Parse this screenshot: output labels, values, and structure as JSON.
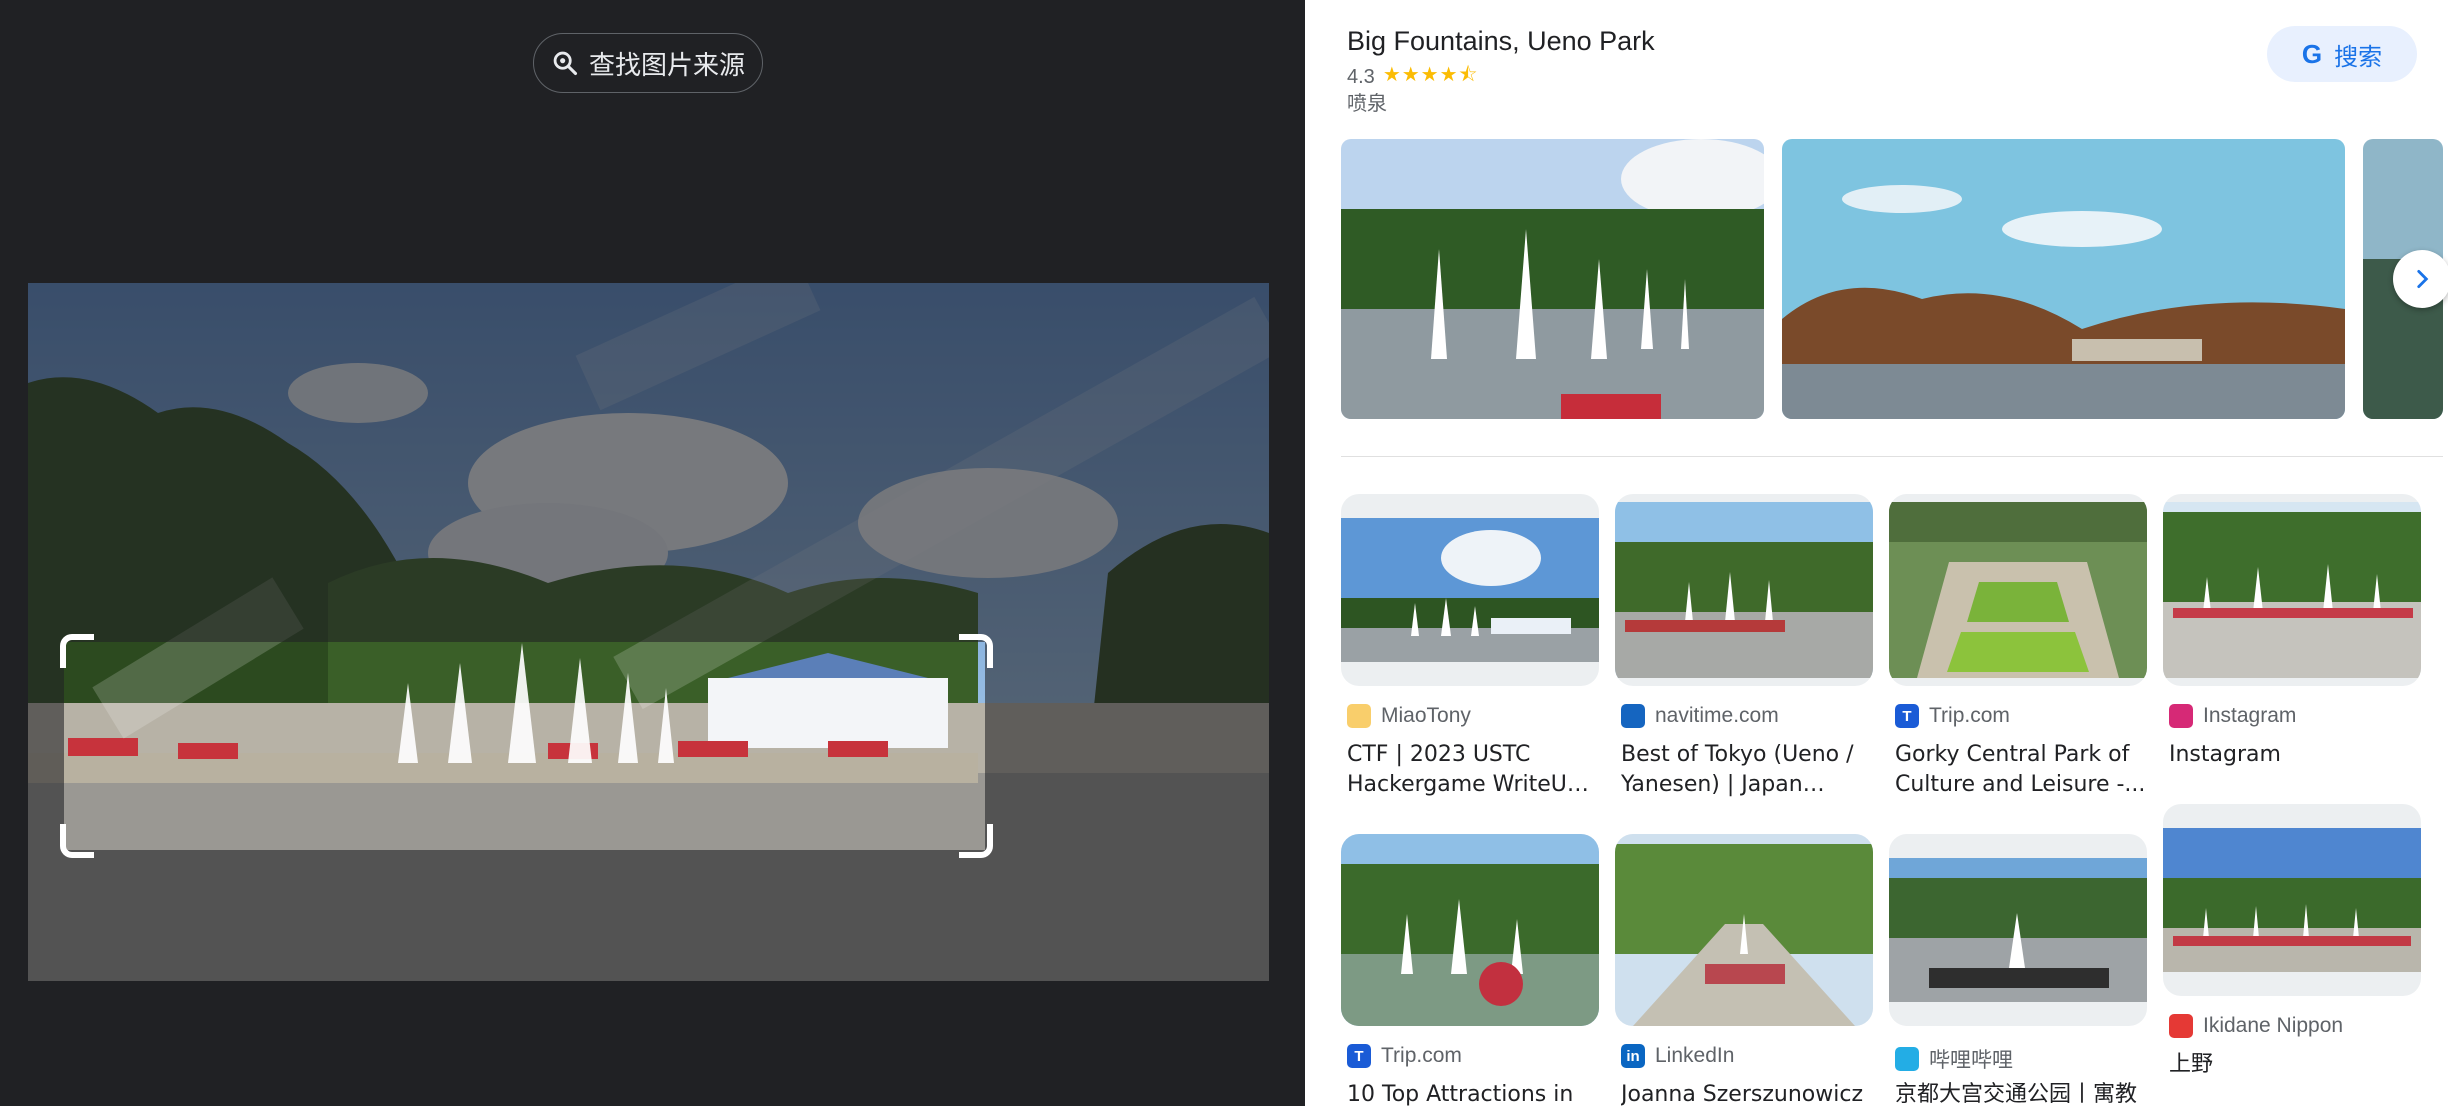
{
  "left_panel": {
    "find_source_label": "查找图片来源"
  },
  "place": {
    "title": "Big Fountains, Ueno Park",
    "rating": "4.3",
    "stars": "★★★★⯪",
    "category": "喷泉",
    "search_label": "搜索",
    "search_logo": "G"
  },
  "results": [
    {
      "source": "MiaoTony",
      "title": "CTF | 2023 USTC Hackergame WriteUp |...",
      "favicon": "notepad-icon",
      "favicon_color": "#f9ce6b"
    },
    {
      "source": "navitime.com",
      "title": "Best of Tokyo (Ueno / Yanesen) | Japan Trave...",
      "favicon": "navitime-icon",
      "favicon_color": "#1565c0"
    },
    {
      "source": "Trip.com",
      "title": "Gorky Central Park of Culture and Leisure -...",
      "favicon": "tripcom-icon",
      "favicon_text": "T",
      "favicon_color": "#1a5bd6"
    },
    {
      "source": "Instagram",
      "title": "Instagram",
      "favicon": "instagram-icon",
      "favicon_color": "#d62976"
    },
    {
      "source": "Trip.com",
      "title": "10 Top Attractions in",
      "favicon": "tripcom-icon",
      "favicon_text": "T",
      "favicon_color": "#1a5bd6"
    },
    {
      "source": "LinkedIn",
      "title": "Joanna Szerszunowicz",
      "favicon": "linkedin-icon",
      "favicon_text": "in",
      "favicon_color": "#0a66c2"
    },
    {
      "source": "哔哩哔哩",
      "title": "京都大宫交通公园丨寓教",
      "favicon": "bilibili-icon",
      "favicon_color": "#23ade5"
    },
    {
      "source": "Ikidane Nippon",
      "title": "上野",
      "favicon": "ikidane-icon",
      "favicon_color": "#e53935"
    }
  ]
}
